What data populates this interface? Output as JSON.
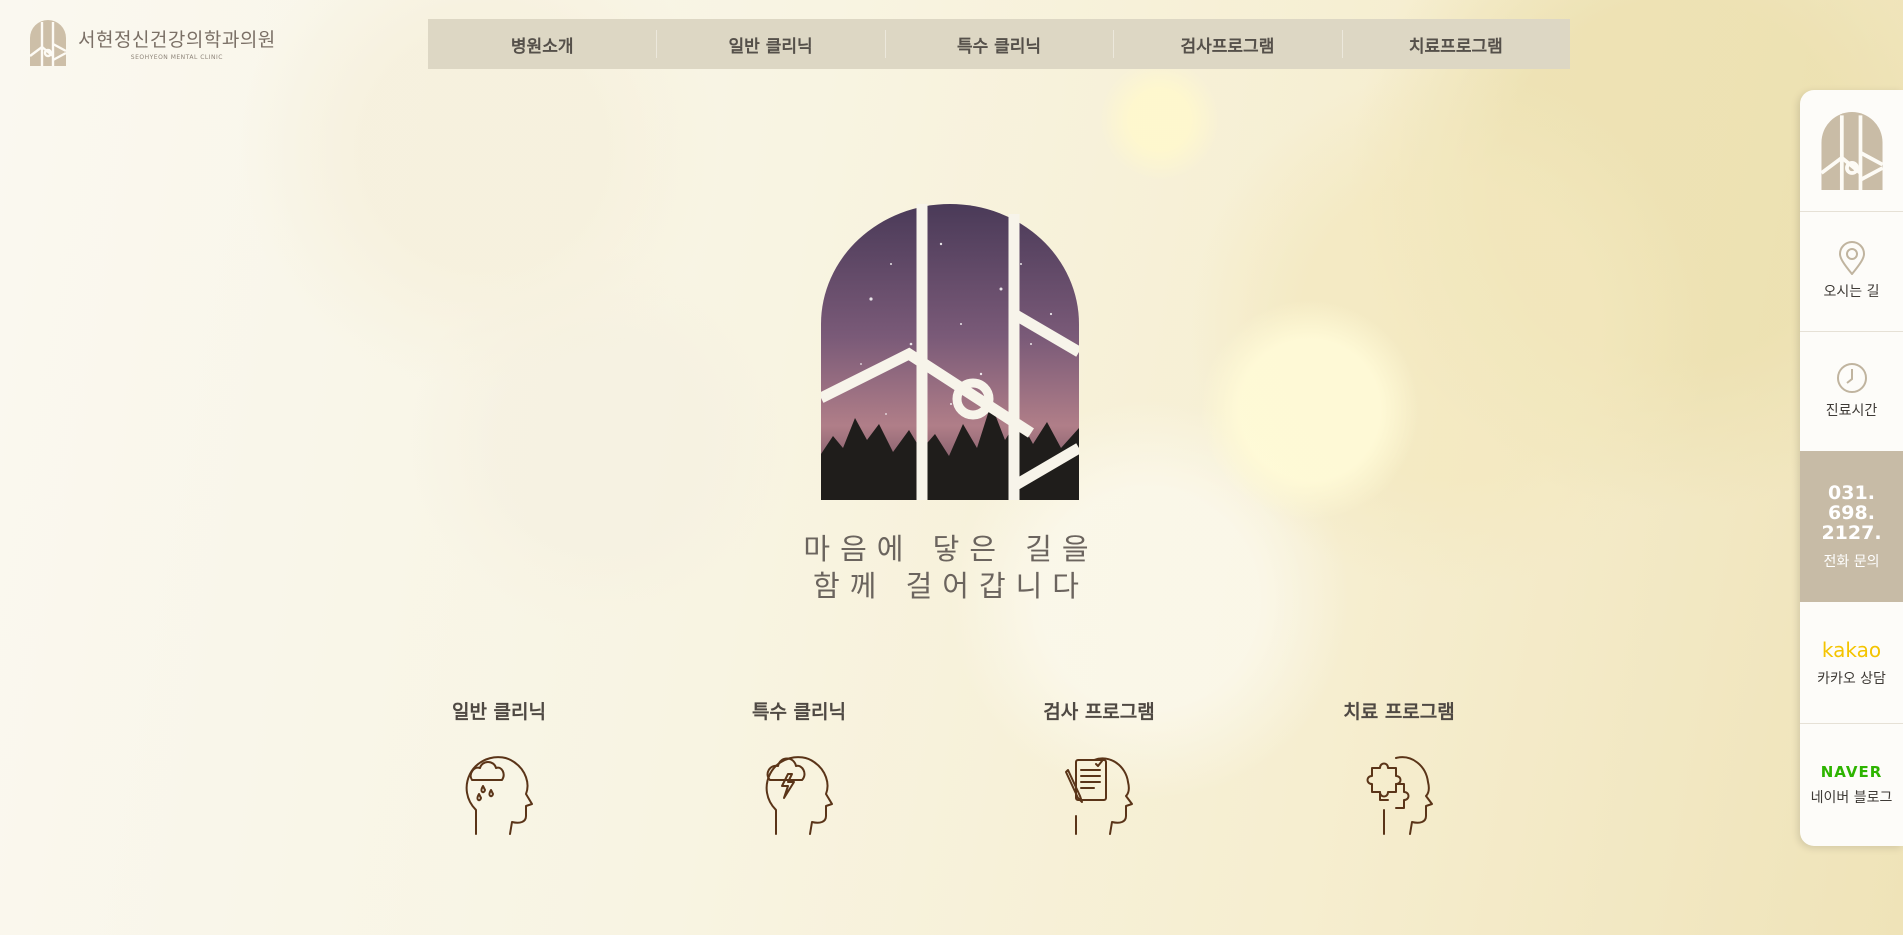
{
  "brand": {
    "name_ko": "서현정신건강의학과의원",
    "name_en": "SEOHYEON MENTAL CLINIC"
  },
  "nav": {
    "items": [
      "병원소개",
      "일반 클리닉",
      "특수 클리닉",
      "검사프로그램",
      "치료프로그램"
    ]
  },
  "hero": {
    "slogan_line1": "마음에 닿은 길을",
    "slogan_line2": "함께 걸어갑니다"
  },
  "categories": [
    {
      "label": "일반 클리닉",
      "icon": "head-raincloud-icon"
    },
    {
      "label": "특수 클리닉",
      "icon": "head-storm-lightning-icon"
    },
    {
      "label": "검사 프로그램",
      "icon": "head-checklist-icon"
    },
    {
      "label": "치료 프로그램",
      "icon": "head-puzzle-icon"
    }
  ],
  "quick_menu": {
    "directions": "오시는 길",
    "hours": "진료시간",
    "phone_lines": [
      "031.",
      "698.",
      "2127."
    ],
    "phone_label": "전화 문의",
    "kakao_logo": "kakao",
    "kakao_label": "카카오 상담",
    "naver_logo": "NAVER",
    "naver_label": "네이버 블로그"
  },
  "colors": {
    "nav_bg": "#ddd7c4",
    "accent_beige": "#c7bba6",
    "icon_brown": "#5a3418",
    "kakao_yellow": "#f4c400",
    "naver_green": "#2db400"
  }
}
